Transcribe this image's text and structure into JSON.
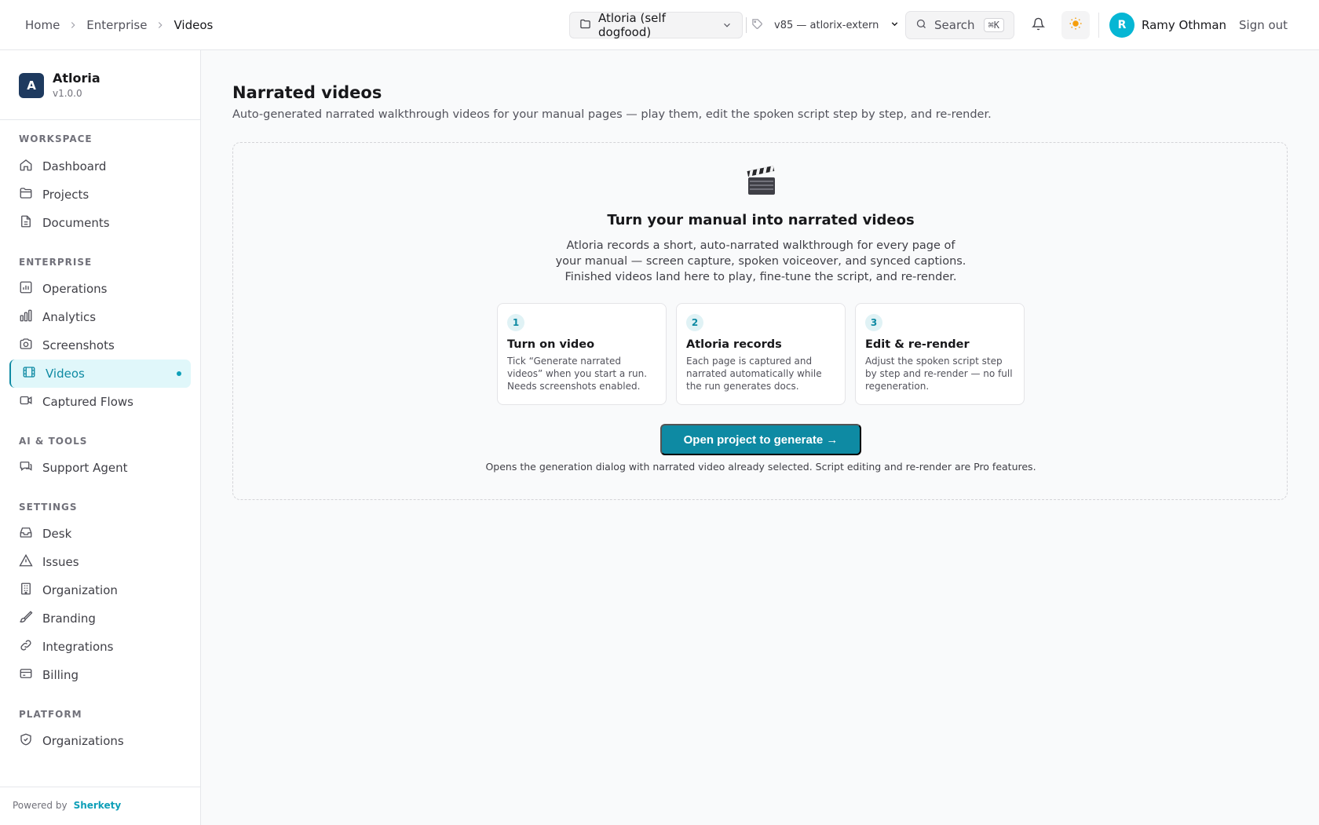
{
  "breadcrumb": [
    "Home",
    "Enterprise",
    "Videos"
  ],
  "header": {
    "project": "Atloria (self dogfood)",
    "version": "v85 — atlorix-extern",
    "search_label": "Search",
    "search_shortcut": "⌘K",
    "user_initial": "R",
    "user_name": "Ramy Othman",
    "sign_out": "Sign out"
  },
  "brand": {
    "initial": "A",
    "name": "Atloria",
    "version": "v1.0.0"
  },
  "sidebar": {
    "sections": [
      "WORKSPACE",
      "ENTERPRISE",
      "AI & TOOLS",
      "SETTINGS",
      "PLATFORM"
    ],
    "items": [
      {
        "label": "Dashboard",
        "icon": "home-icon"
      },
      {
        "label": "Projects",
        "icon": "folder-icon"
      },
      {
        "label": "Documents",
        "icon": "document-icon"
      },
      {
        "label": "Operations",
        "icon": "chart-icon"
      },
      {
        "label": "Analytics",
        "icon": "bar-chart-icon"
      },
      {
        "label": "Screenshots",
        "icon": "camera-icon"
      },
      {
        "label": "Videos",
        "icon": "film-icon",
        "active": true
      },
      {
        "label": "Captured Flows",
        "icon": "video-icon"
      },
      {
        "label": "Support Agent",
        "icon": "chat-icon"
      },
      {
        "label": "Desk",
        "icon": "inbox-icon"
      },
      {
        "label": "Issues",
        "icon": "warning-icon"
      },
      {
        "label": "Organization",
        "icon": "building-icon"
      },
      {
        "label": "Branding",
        "icon": "brush-icon"
      },
      {
        "label": "Integrations",
        "icon": "link-icon"
      },
      {
        "label": "Billing",
        "icon": "card-icon"
      },
      {
        "label": "Organizations",
        "icon": "shield-icon"
      }
    ],
    "powered_by": "Powered by",
    "powered_brand": "Sherkety"
  },
  "main": {
    "title": "Narrated videos",
    "subtitle": "Auto-generated narrated walkthrough videos for your manual pages — play them, edit the spoken script step by step, and re-render.",
    "empty": {
      "title": "Turn your manual into narrated videos",
      "description": "Atloria records a short, auto-narrated walkthrough for every page of your manual — screen capture, spoken voiceover, and synced captions. Finished videos land here to play, fine-tune the script, and re-render.",
      "steps": [
        {
          "num": "1",
          "title": "Turn on video",
          "desc": "Tick “Generate narrated videos” when you start a run. Needs screenshots enabled."
        },
        {
          "num": "2",
          "title": "Atloria records",
          "desc": "Each page is captured and narrated automatically while the run generates docs."
        },
        {
          "num": "3",
          "title": "Edit & re-render",
          "desc": "Adjust the spoken script step by step and re-render — no full regeneration."
        }
      ],
      "cta": "Open project to generate →",
      "note": "Opens the generation dialog with narrated video already selected. Script editing and re-render are Pro features."
    }
  },
  "colors": {
    "accent": "#0e8aa3",
    "active_bg": "#e0f7fa",
    "avatar": "#06b6d4",
    "brand_logo": "#1e3a5f"
  }
}
